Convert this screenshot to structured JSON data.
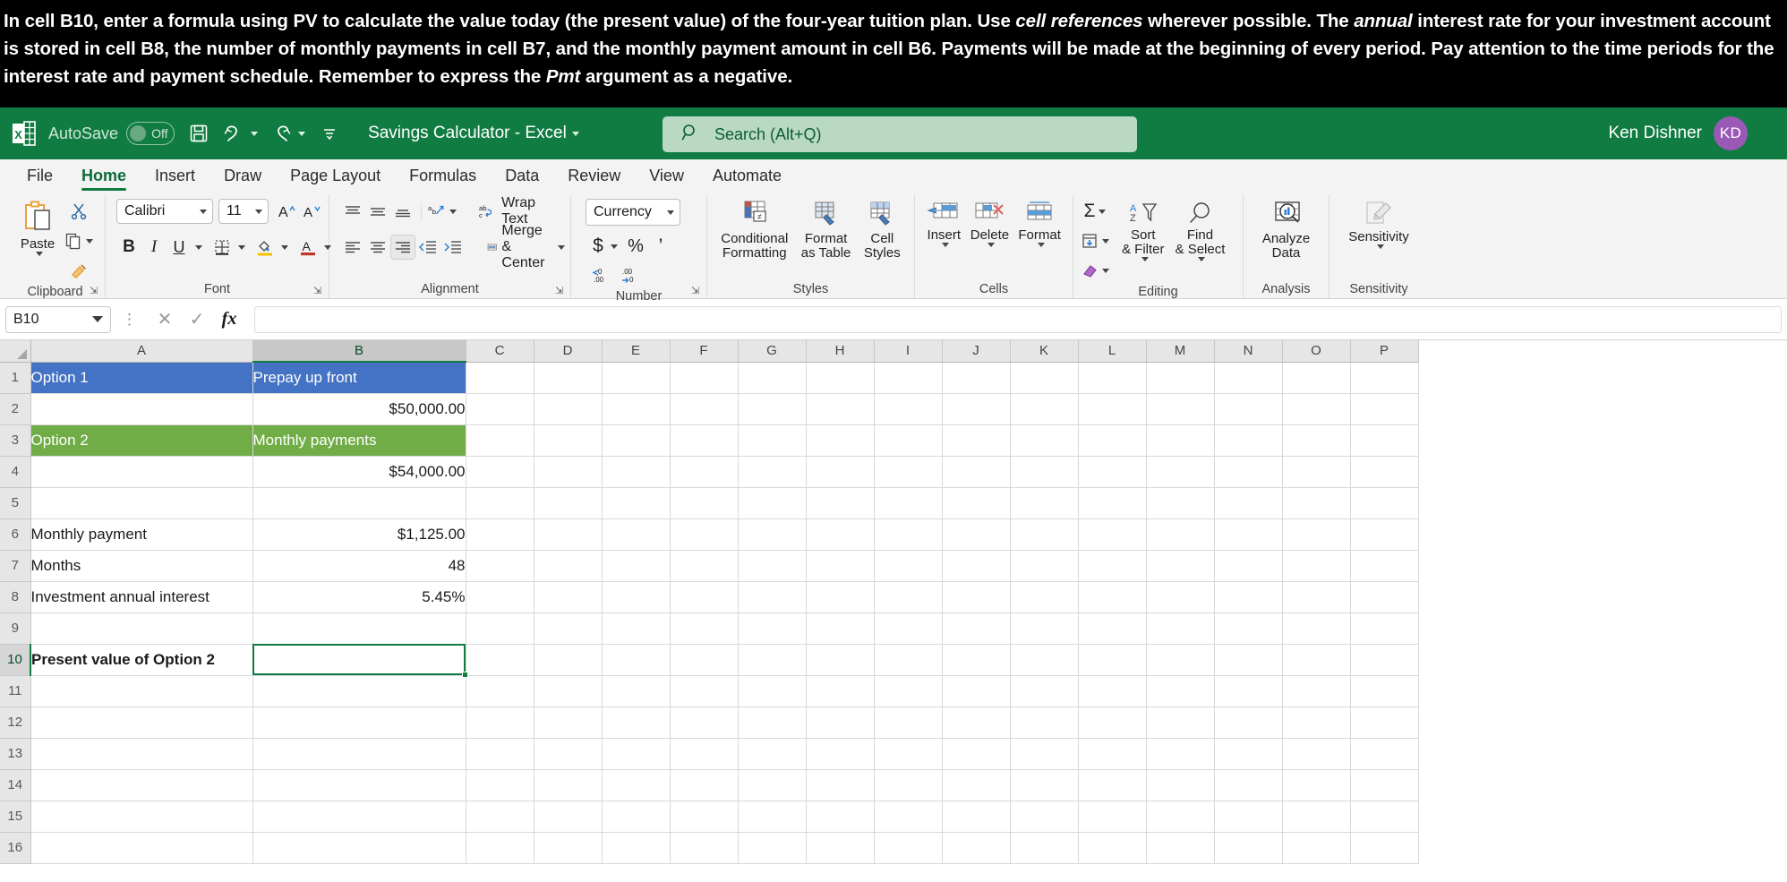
{
  "instruction": {
    "segments": [
      {
        "t": "In cell B10, enter a formula using PV to calculate the value today (the present value) of the four-year tuition plan. Use ",
        "s": "normal"
      },
      {
        "t": "cell references",
        "s": "italic"
      },
      {
        "t": " wherever possible. The ",
        "s": "normal"
      },
      {
        "t": "annual",
        "s": "italic"
      },
      {
        "t": " interest rate for your investment account is stored in cell ",
        "s": "normal"
      },
      {
        "t": "B8",
        "s": "bold"
      },
      {
        "t": ", the number of monthly payments in cell ",
        "s": "normal"
      },
      {
        "t": "B7",
        "s": "bold"
      },
      {
        "t": ", and the monthly payment amount in cell ",
        "s": "normal"
      },
      {
        "t": "B6",
        "s": "bold"
      },
      {
        "t": ". Payments will be made at the beginning of every period. Pay attention to the time periods for the interest rate and payment schedule. Remember to express the ",
        "s": "normal"
      },
      {
        "t": "Pmt",
        "s": "italic"
      },
      {
        "t": " argument as a negative.",
        "s": "normal"
      }
    ]
  },
  "titlebar": {
    "autosave_label": "AutoSave",
    "autosave_state": "Off",
    "document_title": "Savings Calculator - Excel",
    "user_name": "Ken Dishner",
    "user_initials": "KD",
    "accent_color": "#107c41",
    "avatar_color": "#9b59b6"
  },
  "search": {
    "placeholder": "Search (Alt+Q)"
  },
  "ribbon": {
    "tabs": [
      {
        "label": "File",
        "active": false
      },
      {
        "label": "Home",
        "active": true
      },
      {
        "label": "Insert",
        "active": false
      },
      {
        "label": "Draw",
        "active": false
      },
      {
        "label": "Page Layout",
        "active": false
      },
      {
        "label": "Formulas",
        "active": false
      },
      {
        "label": "Data",
        "active": false
      },
      {
        "label": "Review",
        "active": false
      },
      {
        "label": "View",
        "active": false
      },
      {
        "label": "Automate",
        "active": false
      }
    ],
    "groups": {
      "clipboard": {
        "label": "Clipboard",
        "paste": "Paste",
        "cut": "Cut",
        "copy": "Copy",
        "format_painter": "Format Painter"
      },
      "font": {
        "label": "Font",
        "font_name": "Calibri",
        "font_size": "11",
        "grow_font": "A",
        "shrink_font": "A",
        "bold": "B",
        "italic": "I",
        "underline": "U"
      },
      "alignment": {
        "label": "Alignment",
        "wrap_text": "Wrap Text",
        "merge_center": "Merge & Center"
      },
      "number": {
        "label": "Number",
        "format": "Currency",
        "accounting": "$",
        "percent": "%",
        "comma": "’"
      },
      "styles": {
        "label": "Styles",
        "conditional_formatting_line1": "Conditional",
        "conditional_formatting_line2": "Formatting",
        "format_as_table_line1": "Format",
        "format_as_table_line2": "as Table",
        "cell_styles_line1": "Cell",
        "cell_styles_line2": "Styles"
      },
      "cells": {
        "label": "Cells",
        "insert": "Insert",
        "delete": "Delete",
        "format": "Format"
      },
      "editing": {
        "label": "Editing",
        "autosum": "Σ",
        "sort_line1": "Sort",
        "sort_line2": "& Filter",
        "find_line1": "Find",
        "find_line2": "& Select"
      },
      "analysis": {
        "label": "Analysis",
        "analyze_line1": "Analyze",
        "analyze_line2": "Data"
      },
      "sensitivity": {
        "label": "Sensitivity",
        "button": "Sensitivity"
      }
    }
  },
  "formula_bar": {
    "name_box": "B10",
    "formula_value": "",
    "cancel_icon": "✕",
    "enter_icon": "✓",
    "fx_label": "fx"
  },
  "grid": {
    "columns": [
      "A",
      "B",
      "C",
      "D",
      "E",
      "F",
      "G",
      "H",
      "I",
      "J",
      "K",
      "L",
      "M",
      "N",
      "O",
      "P"
    ],
    "selected_column": "B",
    "selected_row": 10,
    "active_cell": "B10",
    "rows": [
      {
        "n": 1,
        "a": "Option 1",
        "b": "Prepay up front",
        "style_a": "blue",
        "style_b": "blue",
        "align_b": "left"
      },
      {
        "n": 2,
        "a": "",
        "b": "$50,000.00",
        "align_b": "right"
      },
      {
        "n": 3,
        "a": "Option 2",
        "b": "Monthly payments",
        "style_a": "green",
        "style_b": "green",
        "align_b": "left"
      },
      {
        "n": 4,
        "a": "",
        "b": "$54,000.00",
        "align_b": "right"
      },
      {
        "n": 5,
        "a": "",
        "b": ""
      },
      {
        "n": 6,
        "a": "Monthly payment",
        "b": "$1,125.00",
        "align_b": "right"
      },
      {
        "n": 7,
        "a": "Months",
        "b": "48",
        "align_b": "right"
      },
      {
        "n": 8,
        "a": "Investment annual interest",
        "b": "5.45%",
        "align_b": "right"
      },
      {
        "n": 9,
        "a": "",
        "b": ""
      },
      {
        "n": 10,
        "a": "Present value of Option 2",
        "b": "",
        "style_a": "bold"
      },
      {
        "n": 11,
        "a": "",
        "b": ""
      },
      {
        "n": 12,
        "a": "",
        "b": ""
      },
      {
        "n": 13,
        "a": "",
        "b": ""
      },
      {
        "n": 14,
        "a": "",
        "b": ""
      },
      {
        "n": 15,
        "a": "",
        "b": ""
      },
      {
        "n": 16,
        "a": "",
        "b": ""
      }
    ],
    "colors": {
      "option1_fill": "#4472c4",
      "option2_fill": "#70ad47",
      "selection_border": "#107c41"
    }
  }
}
